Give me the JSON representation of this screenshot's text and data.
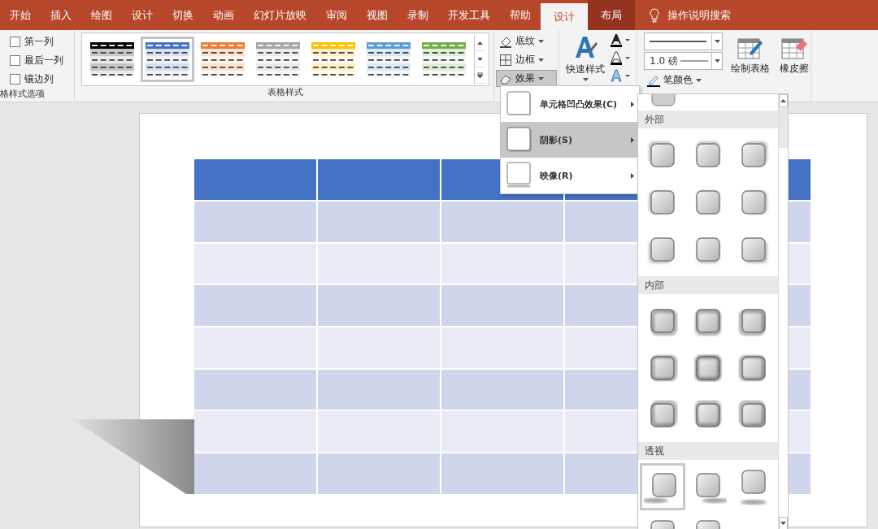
{
  "tabs": [
    {
      "label": "开始",
      "selected": false,
      "kind": "normal"
    },
    {
      "label": "插入",
      "selected": false,
      "kind": "normal"
    },
    {
      "label": "绘图",
      "selected": false,
      "kind": "normal"
    },
    {
      "label": "设计",
      "selected": false,
      "kind": "normal"
    },
    {
      "label": "切换",
      "selected": false,
      "kind": "normal"
    },
    {
      "label": "动画",
      "selected": false,
      "kind": "normal"
    },
    {
      "label": "幻灯片放映",
      "selected": false,
      "kind": "normal"
    },
    {
      "label": "审阅",
      "selected": false,
      "kind": "normal"
    },
    {
      "label": "视图",
      "selected": false,
      "kind": "normal"
    },
    {
      "label": "录制",
      "selected": false,
      "kind": "normal"
    },
    {
      "label": "开发工具",
      "selected": false,
      "kind": "normal"
    },
    {
      "label": "帮助",
      "selected": false,
      "kind": "normal"
    },
    {
      "label": "设计",
      "selected": true,
      "kind": "contextual"
    },
    {
      "label": "布局",
      "selected": false,
      "kind": "contextual"
    }
  ],
  "search": {
    "label": "操作说明搜索"
  },
  "style_options": {
    "group_label": "格样式选项",
    "items": [
      {
        "label": "第一列",
        "checked": false
      },
      {
        "label": "最后一列",
        "checked": false
      },
      {
        "label": "镶边列",
        "checked": false
      }
    ]
  },
  "table_styles": {
    "group_label": "表格样式",
    "items": [
      {
        "color": "#000000",
        "selected": false
      },
      {
        "color": "#4472c4",
        "selected": true
      },
      {
        "color": "#ed7d31",
        "selected": false
      },
      {
        "color": "#a5a5a5",
        "selected": false
      },
      {
        "color": "#ffc000",
        "selected": false
      },
      {
        "color": "#5b9bd5",
        "selected": false
      },
      {
        "color": "#70ad47",
        "selected": false
      }
    ]
  },
  "format_buttons": [
    {
      "kind": "shading",
      "label": "底纹",
      "pressed": false
    },
    {
      "kind": "border",
      "label": "边框",
      "pressed": false
    },
    {
      "kind": "effects",
      "label": "效果",
      "pressed": true
    }
  ],
  "wordart": {
    "label": "快速样式"
  },
  "draw_borders": {
    "weight": "1.0 磅",
    "pen_color": "笔颜色",
    "draw_table": "绘制表格",
    "eraser": "橡皮擦"
  },
  "effects_menu": [
    {
      "label": "单元格凹凸效果(C)",
      "selected": false,
      "kind": "bevel"
    },
    {
      "label": "阴影(S)",
      "selected": true,
      "kind": "shadow"
    },
    {
      "label": "映像(R)",
      "selected": false,
      "kind": "reflection"
    }
  ],
  "shadow_gallery": [
    {
      "title": "外部",
      "kind": "outer",
      "items": [
        {
          "selected": false
        },
        {
          "selected": false
        },
        {
          "selected": false
        },
        {
          "selected": false
        },
        {
          "selected": false
        },
        {
          "selected": false
        },
        {
          "selected": false
        },
        {
          "selected": false
        },
        {
          "selected": false
        }
      ]
    },
    {
      "title": "内部",
      "kind": "inner",
      "items": [
        {
          "selected": false
        },
        {
          "selected": false
        },
        {
          "selected": false
        },
        {
          "selected": false
        },
        {
          "selected": false
        },
        {
          "selected": false
        },
        {
          "selected": false
        },
        {
          "selected": false
        },
        {
          "selected": false
        }
      ]
    },
    {
      "title": "透视",
      "kind": "perspective",
      "items": [
        {
          "selected": true
        },
        {
          "selected": false
        },
        {
          "selected": false
        },
        {
          "selected": false
        },
        {
          "selected": false
        }
      ]
    }
  ]
}
